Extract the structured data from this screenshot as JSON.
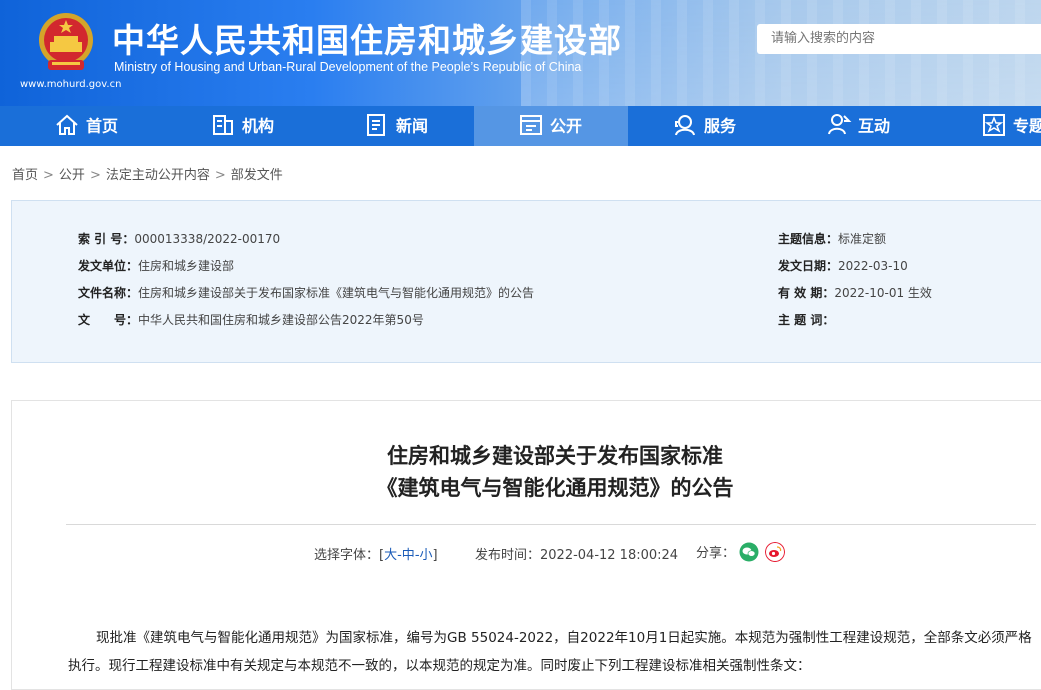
{
  "header": {
    "title_cn": "中华人民共和国住房和城乡建设部",
    "title_en": "Ministry of Housing and Urban-Rural Development of the People’s Republic of China",
    "url": "www.mohurd.gov.cn",
    "search_placeholder": "请输入搜索的内容"
  },
  "nav": {
    "items": [
      {
        "label": "首页",
        "icon": "home-icon"
      },
      {
        "label": "机构",
        "icon": "org-icon"
      },
      {
        "label": "新闻",
        "icon": "news-icon"
      },
      {
        "label": "公开",
        "icon": "public-icon"
      },
      {
        "label": "服务",
        "icon": "service-icon"
      },
      {
        "label": "互动",
        "icon": "interact-icon"
      },
      {
        "label": "专题",
        "icon": "topic-icon"
      }
    ],
    "active": "公开"
  },
  "breadcrumb": [
    "首页",
    "公开",
    "法定主动公开内容",
    "部发文件"
  ],
  "info": {
    "index_label": "索 引 号：",
    "index_value": "000013338/2022-00170",
    "issuer_label": "发文单位：",
    "issuer_value": "住房和城乡建设部",
    "docname_label": "文件名称：",
    "docname_value": "住房和城乡建设部关于发布国家标准《建筑电气与智能化通用规范》的公告",
    "docno_label": "文　　号：",
    "docno_value": "中华人民共和国住房和城乡建设部公告2022年第50号",
    "topic_label": "主题信息：",
    "topic_value": "标准定额",
    "date_label": "发文日期：",
    "date_value": "2022-03-10",
    "valid_label": "有 效 期：",
    "valid_value": "2022-10-01 生效",
    "keyword_label": "主 题 词：",
    "keyword_value": ""
  },
  "article": {
    "title_line1": "住房和城乡建设部关于发布国家标准",
    "title_line2": "《建筑电气与智能化通用规范》的公告",
    "font_label": "选择字体：[",
    "font_large": "大",
    "font_mid": "中",
    "font_small": "小",
    "font_close": "]",
    "publish_label": "发布时间：2022-04-12 18:00:24",
    "share_label": "分享：",
    "paragraph": "现批准《建筑电气与智能化通用规范》为国家标准，编号为GB 55024-2022，自2022年10月1日起实施。本规范为强制性工程建设规范，全部条文必须严格执行。现行工程建设标准中有关规定与本规范不一致的，以本规范的规定为准。同时废止下列工程建设标准相关强制性条文："
  },
  "colors": {
    "nav_bg": "#1a6fd9",
    "nav_active": "#5596e4",
    "info_bg": "#eef5fc",
    "wechat": "#2aae67",
    "weibo": "#e6162d"
  }
}
